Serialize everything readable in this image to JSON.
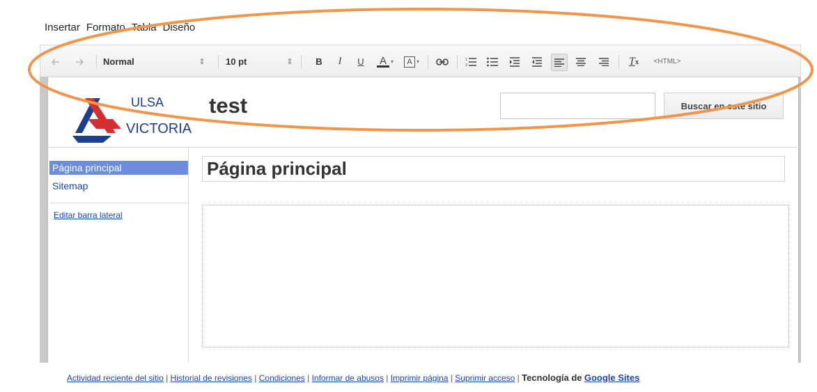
{
  "menu": [
    "Insertar",
    "Formato",
    "Tabla",
    "Diseño"
  ],
  "toolbar": {
    "undo_icon": "undo-icon",
    "redo_icon": "redo-icon",
    "style_value": "Normal",
    "size_value": "10 pt",
    "bold": "B",
    "italic": "I",
    "underline": "U",
    "text_color": "A",
    "bg_color": "A",
    "html_label": "<HTML>"
  },
  "site": {
    "logo_line1": "ULSA",
    "logo_line2": "VICTORIA",
    "title": "test",
    "search_placeholder": "",
    "search_button": "Buscar en este sitio"
  },
  "sidebar": {
    "items": [
      "Página principal",
      "Sitemap"
    ],
    "active_index": 0,
    "edit_link": "Editar barra lateral"
  },
  "page": {
    "title": "Página principal",
    "body": ""
  },
  "footer": {
    "links": [
      "Actividad reciente del sitio",
      "Historial de revisiones",
      "Condiciones",
      "Informar de abusos",
      "Imprimir página",
      "Suprimir acceso"
    ],
    "powered_by": "Tecnología de",
    "brand": "Google Sites"
  },
  "colors": {
    "annotation": "#f0954a",
    "nav_active_bg": "#6b8ddb",
    "link": "#1a44b8"
  }
}
